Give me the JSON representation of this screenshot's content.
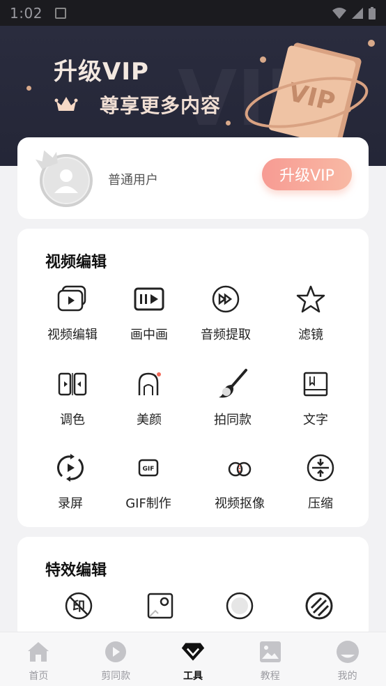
{
  "status_bar": {
    "time": "1:02"
  },
  "banner": {
    "title": "升级VIP",
    "subtitle": "尊享更多内容",
    "badge_text": "VIP"
  },
  "user": {
    "name": "普通用户",
    "upgrade_label": "升级VIP"
  },
  "video_section": {
    "title": "视频编辑",
    "tools": [
      {
        "label": "视频编辑",
        "icon": "video-stack-icon"
      },
      {
        "label": "画中画",
        "icon": "picture-in-picture-icon"
      },
      {
        "label": "音频提取",
        "icon": "audio-extract-icon"
      },
      {
        "label": "滤镜",
        "icon": "star-icon"
      },
      {
        "label": "调色",
        "icon": "color-adjust-icon"
      },
      {
        "label": "美颜",
        "icon": "beauty-icon"
      },
      {
        "label": "拍同款",
        "icon": "brush-icon"
      },
      {
        "label": "文字",
        "icon": "text-icon"
      },
      {
        "label": "录屏",
        "icon": "screen-record-icon"
      },
      {
        "label": "GIF制作",
        "icon": "gif-icon"
      },
      {
        "label": "视频抠像",
        "icon": "matting-icon"
      },
      {
        "label": "压缩",
        "icon": "compress-icon"
      }
    ]
  },
  "fx_section": {
    "title": "特效编辑",
    "icons": [
      "remove-watermark-icon",
      "frame-icon",
      "circle-icon",
      "stripes-icon"
    ],
    "watermark_glyph": "印"
  },
  "bottom_nav": [
    {
      "label": "首页",
      "icon": "home-icon"
    },
    {
      "label": "剪同款",
      "icon": "template-icon"
    },
    {
      "label": "工具",
      "icon": "diamond-icon",
      "active": true
    },
    {
      "label": "教程",
      "icon": "image-icon"
    },
    {
      "label": "我的",
      "icon": "profile-icon"
    }
  ],
  "colors": {
    "accent": "#f79b93",
    "banner_bg": "#262838",
    "card_bg": "#ffffff"
  }
}
